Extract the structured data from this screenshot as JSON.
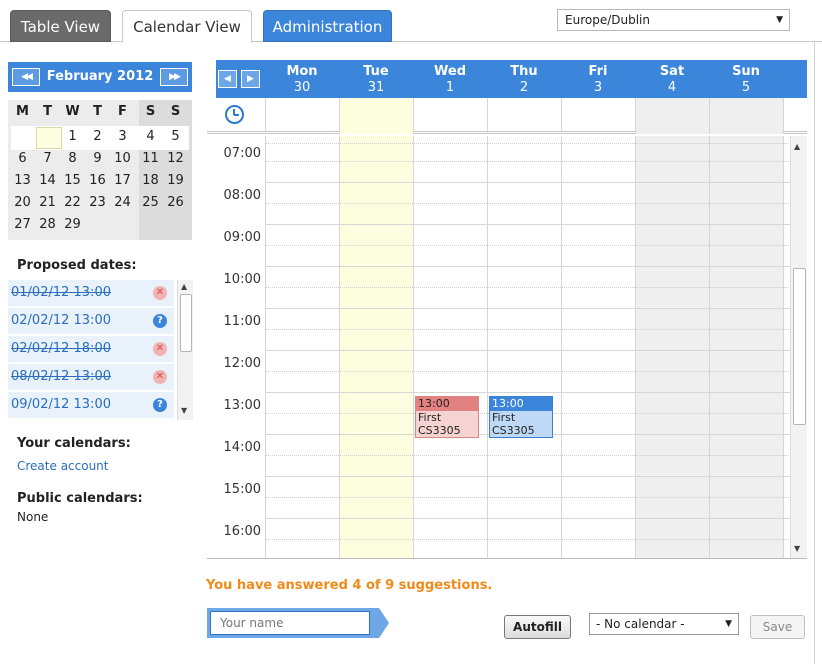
{
  "tabs": [
    {
      "label": "Table View",
      "active": false
    },
    {
      "label": "Calendar View",
      "active": true
    },
    {
      "label": "Administration",
      "active": false
    }
  ],
  "timezone": {
    "selected": "Europe/Dublin"
  },
  "mini_calendar": {
    "month_label": "February 2012",
    "weekdays": [
      "M",
      "T",
      "W",
      "T",
      "F",
      "S",
      "S"
    ],
    "weeks": [
      [
        "",
        "",
        "1",
        "2",
        "3",
        "4",
        "5"
      ],
      [
        "6",
        "7",
        "8",
        "9",
        "10",
        "11",
        "12"
      ],
      [
        "13",
        "14",
        "15",
        "16",
        "17",
        "18",
        "19"
      ],
      [
        "20",
        "21",
        "22",
        "23",
        "24",
        "25",
        "26"
      ],
      [
        "27",
        "28",
        "29",
        "",
        "",
        "",
        ""
      ]
    ]
  },
  "proposed": {
    "title": "Proposed dates:",
    "items": [
      {
        "label": "01/02/12 13:00",
        "struck": true,
        "status": "rejected",
        "symbol": "✕"
      },
      {
        "label": "02/02/12 13:00",
        "struck": false,
        "status": "unknown",
        "symbol": "?"
      },
      {
        "label": "02/02/12 18:00",
        "struck": true,
        "status": "rejected",
        "symbol": "✕"
      },
      {
        "label": "08/02/12 13:00",
        "struck": true,
        "status": "rejected",
        "symbol": "✕"
      },
      {
        "label": "09/02/12 13:00",
        "struck": false,
        "status": "unknown",
        "symbol": "?"
      }
    ]
  },
  "your_calendars": {
    "title": "Your calendars:",
    "link": "Create account"
  },
  "public_calendars": {
    "title": "Public calendars:",
    "value": "None"
  },
  "week": {
    "days": [
      {
        "name": "Mon",
        "date": "30",
        "highlight": false,
        "weekend": false
      },
      {
        "name": "Tue",
        "date": "31",
        "highlight": true,
        "weekend": false
      },
      {
        "name": "Wed",
        "date": "1",
        "highlight": false,
        "weekend": false
      },
      {
        "name": "Thu",
        "date": "2",
        "highlight": false,
        "weekend": false
      },
      {
        "name": "Fri",
        "date": "3",
        "highlight": false,
        "weekend": false
      },
      {
        "name": "Sat",
        "date": "4",
        "highlight": false,
        "weekend": true
      },
      {
        "name": "Sun",
        "date": "5",
        "highlight": false,
        "weekend": true
      }
    ],
    "hours": [
      "07:00",
      "08:00",
      "09:00",
      "10:00",
      "11:00",
      "12:00",
      "13:00",
      "14:00",
      "15:00",
      "16:00"
    ],
    "events": [
      {
        "day": "Wed",
        "time": "13:00",
        "title": "First CS3305",
        "color": "#e38080"
      },
      {
        "day": "Thu",
        "time": "13:00",
        "title": "First CS3305",
        "color": "#3b86db"
      }
    ]
  },
  "footer": {
    "answered": "You have answered 4 of 9 suggestions.",
    "name_placeholder": "Your name",
    "autofill": "Autofill",
    "calendar_select": "- No calendar -",
    "save": "Save"
  },
  "icons": {
    "prev_month": "double-left-arrow-icon",
    "next_month": "double-right-arrow-icon",
    "prev_week": "left-arrow-icon",
    "next_week": "right-arrow-icon",
    "clock": "clock-icon",
    "rejected": "close-icon",
    "unknown": "question-icon"
  },
  "colors": {
    "accent": "#3b86db",
    "today": "#fdfde0",
    "weekend": "#efefef",
    "warning_text": "#f08a1a",
    "rejected": "#e38080"
  }
}
